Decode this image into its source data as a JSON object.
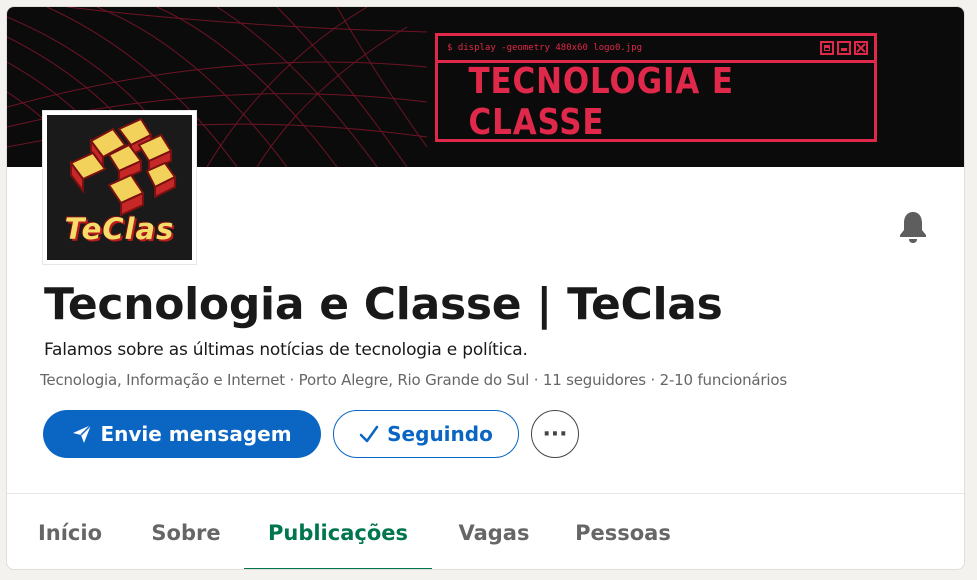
{
  "banner": {
    "terminal_command": "$ display -geometry 480x60 logo0.jpg",
    "brand_text": "TECNOLOGIA E CLASSE",
    "accent_color": "#e0294a"
  },
  "logo": {
    "wordmark": "TeClas"
  },
  "company": {
    "name": "Tecnologia e Classe | TeClas",
    "tagline": "Falamos sobre as últimas notícias de tecnologia e política.",
    "meta": "Tecnologia, Informação e Internet · Porto Alegre, Rio Grande do Sul · 11 seguidores · 2-10 funcionários"
  },
  "actions": {
    "message_label": "Envie mensagem",
    "following_label": "Seguindo",
    "more_label": "···"
  },
  "tabs": [
    {
      "label": "Início",
      "active": false
    },
    {
      "label": "Sobre",
      "active": false
    },
    {
      "label": "Publicações",
      "active": true
    },
    {
      "label": "Vagas",
      "active": false
    },
    {
      "label": "Pessoas",
      "active": false
    }
  ],
  "colors": {
    "primary": "#0a66c2",
    "active_tab": "#01754f"
  },
  "icons": {
    "bell": "bell-icon",
    "send": "send-icon",
    "check": "check-icon"
  }
}
